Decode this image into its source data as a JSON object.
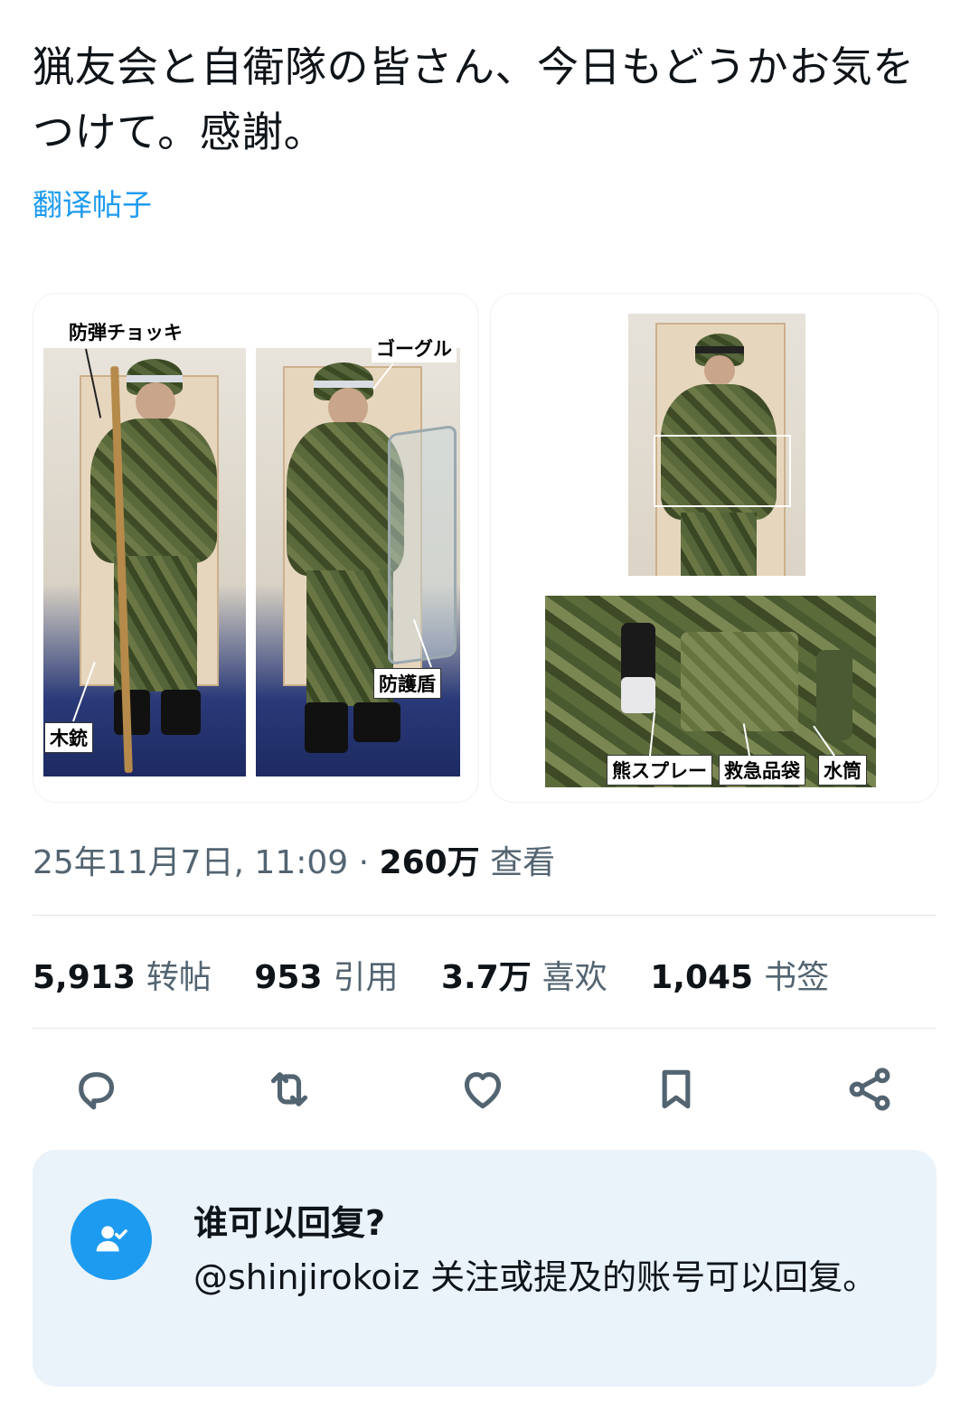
{
  "post": {
    "text": "猟友会と自衛隊の皆さん、今日もどうかお気をつけて。感謝。",
    "translate_label": "翻译帖子"
  },
  "media": {
    "left_labels": {
      "vest": "防弾チョッキ",
      "goggles": "ゴーグル",
      "wooden_rifle": "木銃",
      "shield": "防護盾"
    },
    "right_labels": {
      "bear_spray": "熊スプレー",
      "first_aid_pouch": "救急品袋",
      "canteen": "水筒"
    }
  },
  "meta": {
    "date": "25年11月7日, 11:09",
    "separator": "·",
    "views_count": "260万",
    "views_label": "查看"
  },
  "stats": [
    {
      "count": "5,913",
      "label": "转帖"
    },
    {
      "count": "953",
      "label": "引用"
    },
    {
      "count": "3.7万",
      "label": "喜欢"
    },
    {
      "count": "1,045",
      "label": "书签"
    }
  ],
  "actions": [
    "reply-icon",
    "repost-icon",
    "like-icon",
    "bookmark-icon",
    "share-icon"
  ],
  "reply_restriction": {
    "title": "谁可以回复?",
    "description": "@shinjirokoiz 关注或提及的账号可以回复。",
    "icon": "user-check-icon"
  },
  "colors": {
    "accent": "#1d9bf0",
    "text": "#0f1419",
    "muted": "#536471",
    "reply_bg": "#eaf3fa"
  }
}
